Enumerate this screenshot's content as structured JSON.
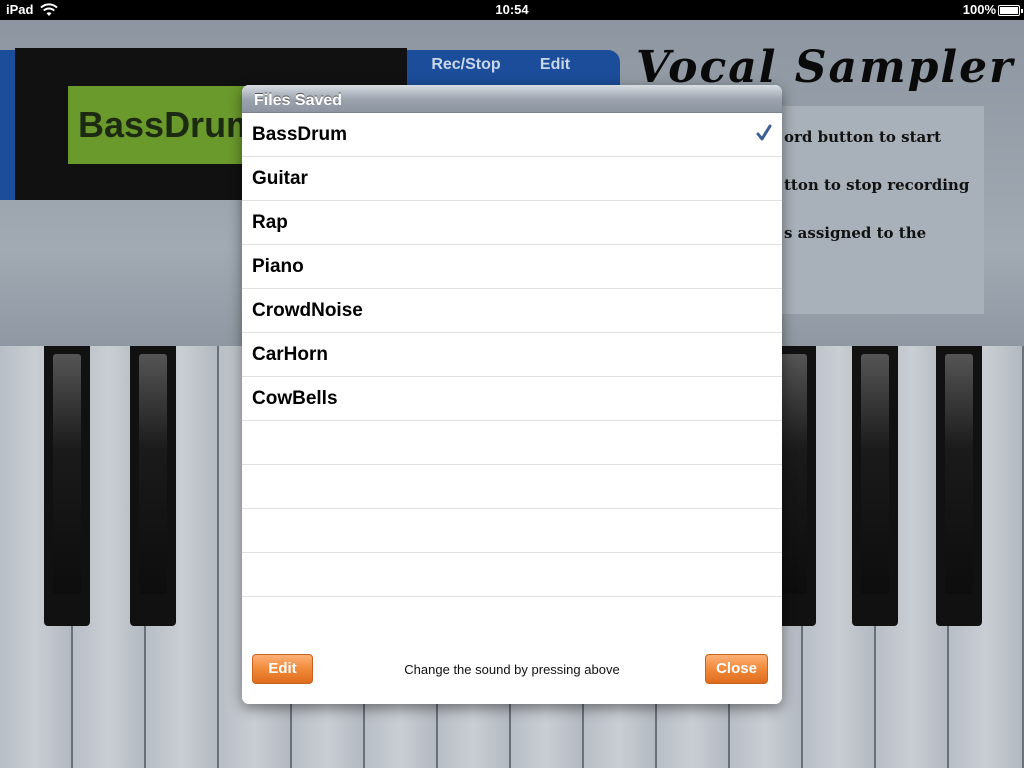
{
  "status_bar": {
    "carrier": "iPad",
    "time": "10:54",
    "battery_percent_label": "100%",
    "battery_level": 1.0
  },
  "background_app": {
    "lcd_text": "BassDrum",
    "rec_stop_label": "Rec/Stop",
    "edit_label": "Edit",
    "title": "Vocal Sampler",
    "instructions": [
      "ord button to start",
      "tton to stop recording",
      "s assigned to the"
    ]
  },
  "modal": {
    "title": "Files Saved",
    "items": [
      {
        "label": "BassDrum",
        "checked": true
      },
      {
        "label": "Guitar",
        "checked": false
      },
      {
        "label": "Rap",
        "checked": false
      },
      {
        "label": "Piano",
        "checked": false
      },
      {
        "label": "CrowdNoise",
        "checked": false
      },
      {
        "label": "CarHorn",
        "checked": false
      },
      {
        "label": "CowBells",
        "checked": false
      }
    ],
    "empty_rows": 5,
    "footer": {
      "edit_label": "Edit",
      "hint": "Change the sound by pressing above",
      "close_label": "Close"
    }
  },
  "colors": {
    "accent_orange": "#f08a3a",
    "checkmark": "#3b5f95",
    "lcd_green": "#6b9a2c",
    "panel_blue": "#1c4d9a"
  },
  "icons": {
    "checkmark": "check-icon",
    "wifi": "wifi-icon",
    "battery": "battery-icon"
  }
}
